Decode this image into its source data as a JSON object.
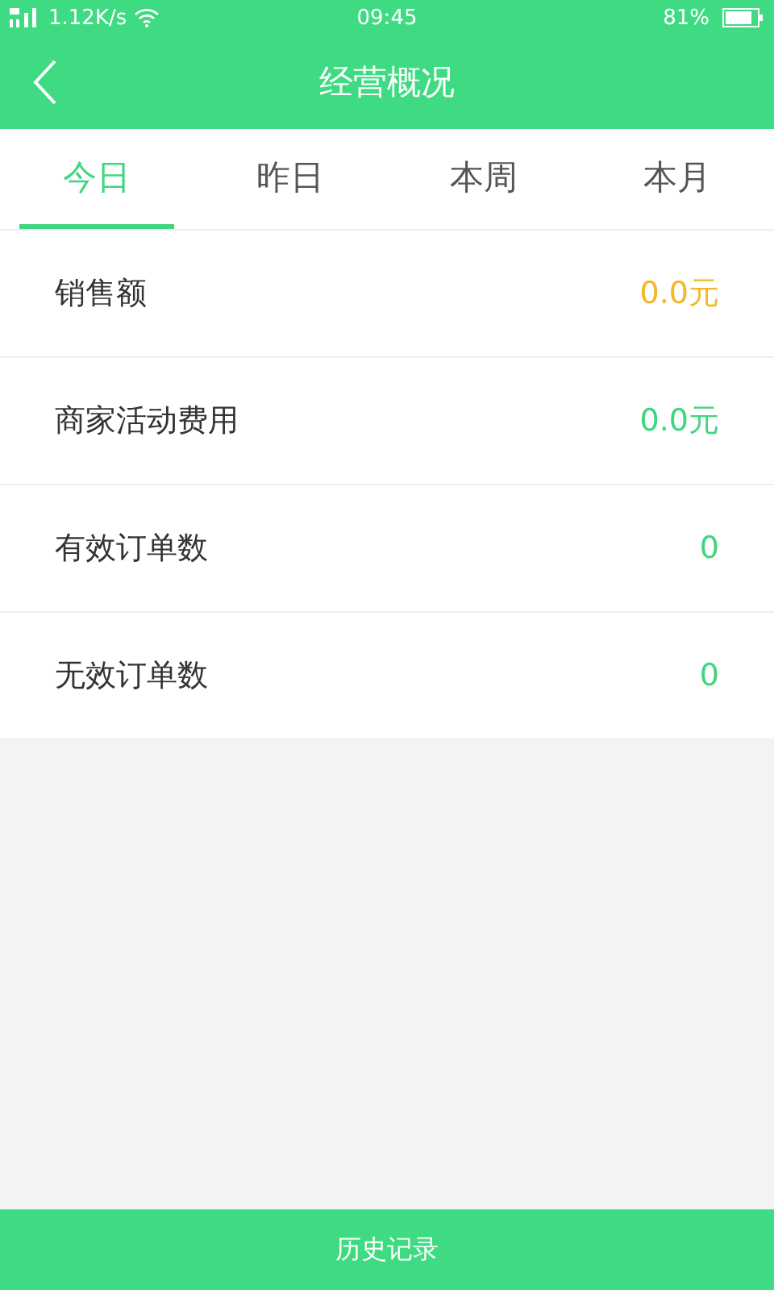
{
  "status_bar": {
    "speed": "1.12K/s",
    "time": "09:45",
    "battery": "81%"
  },
  "header": {
    "title": "经营概况"
  },
  "tabs": [
    {
      "label": "今日",
      "selected": true
    },
    {
      "label": "昨日",
      "selected": false
    },
    {
      "label": "本周",
      "selected": false
    },
    {
      "label": "本月",
      "selected": false
    }
  ],
  "rows": [
    {
      "label": "销售额",
      "value": "0.0元",
      "color": "#f5b62a"
    },
    {
      "label": "商家活动费用",
      "value": "0.0元",
      "color": "#3fd67f"
    },
    {
      "label": "有效订单数",
      "value": "0",
      "color": "#3fd67f"
    },
    {
      "label": "无效订单数",
      "value": "0",
      "color": "#3fd67f"
    }
  ],
  "footer_button": "历史记录"
}
